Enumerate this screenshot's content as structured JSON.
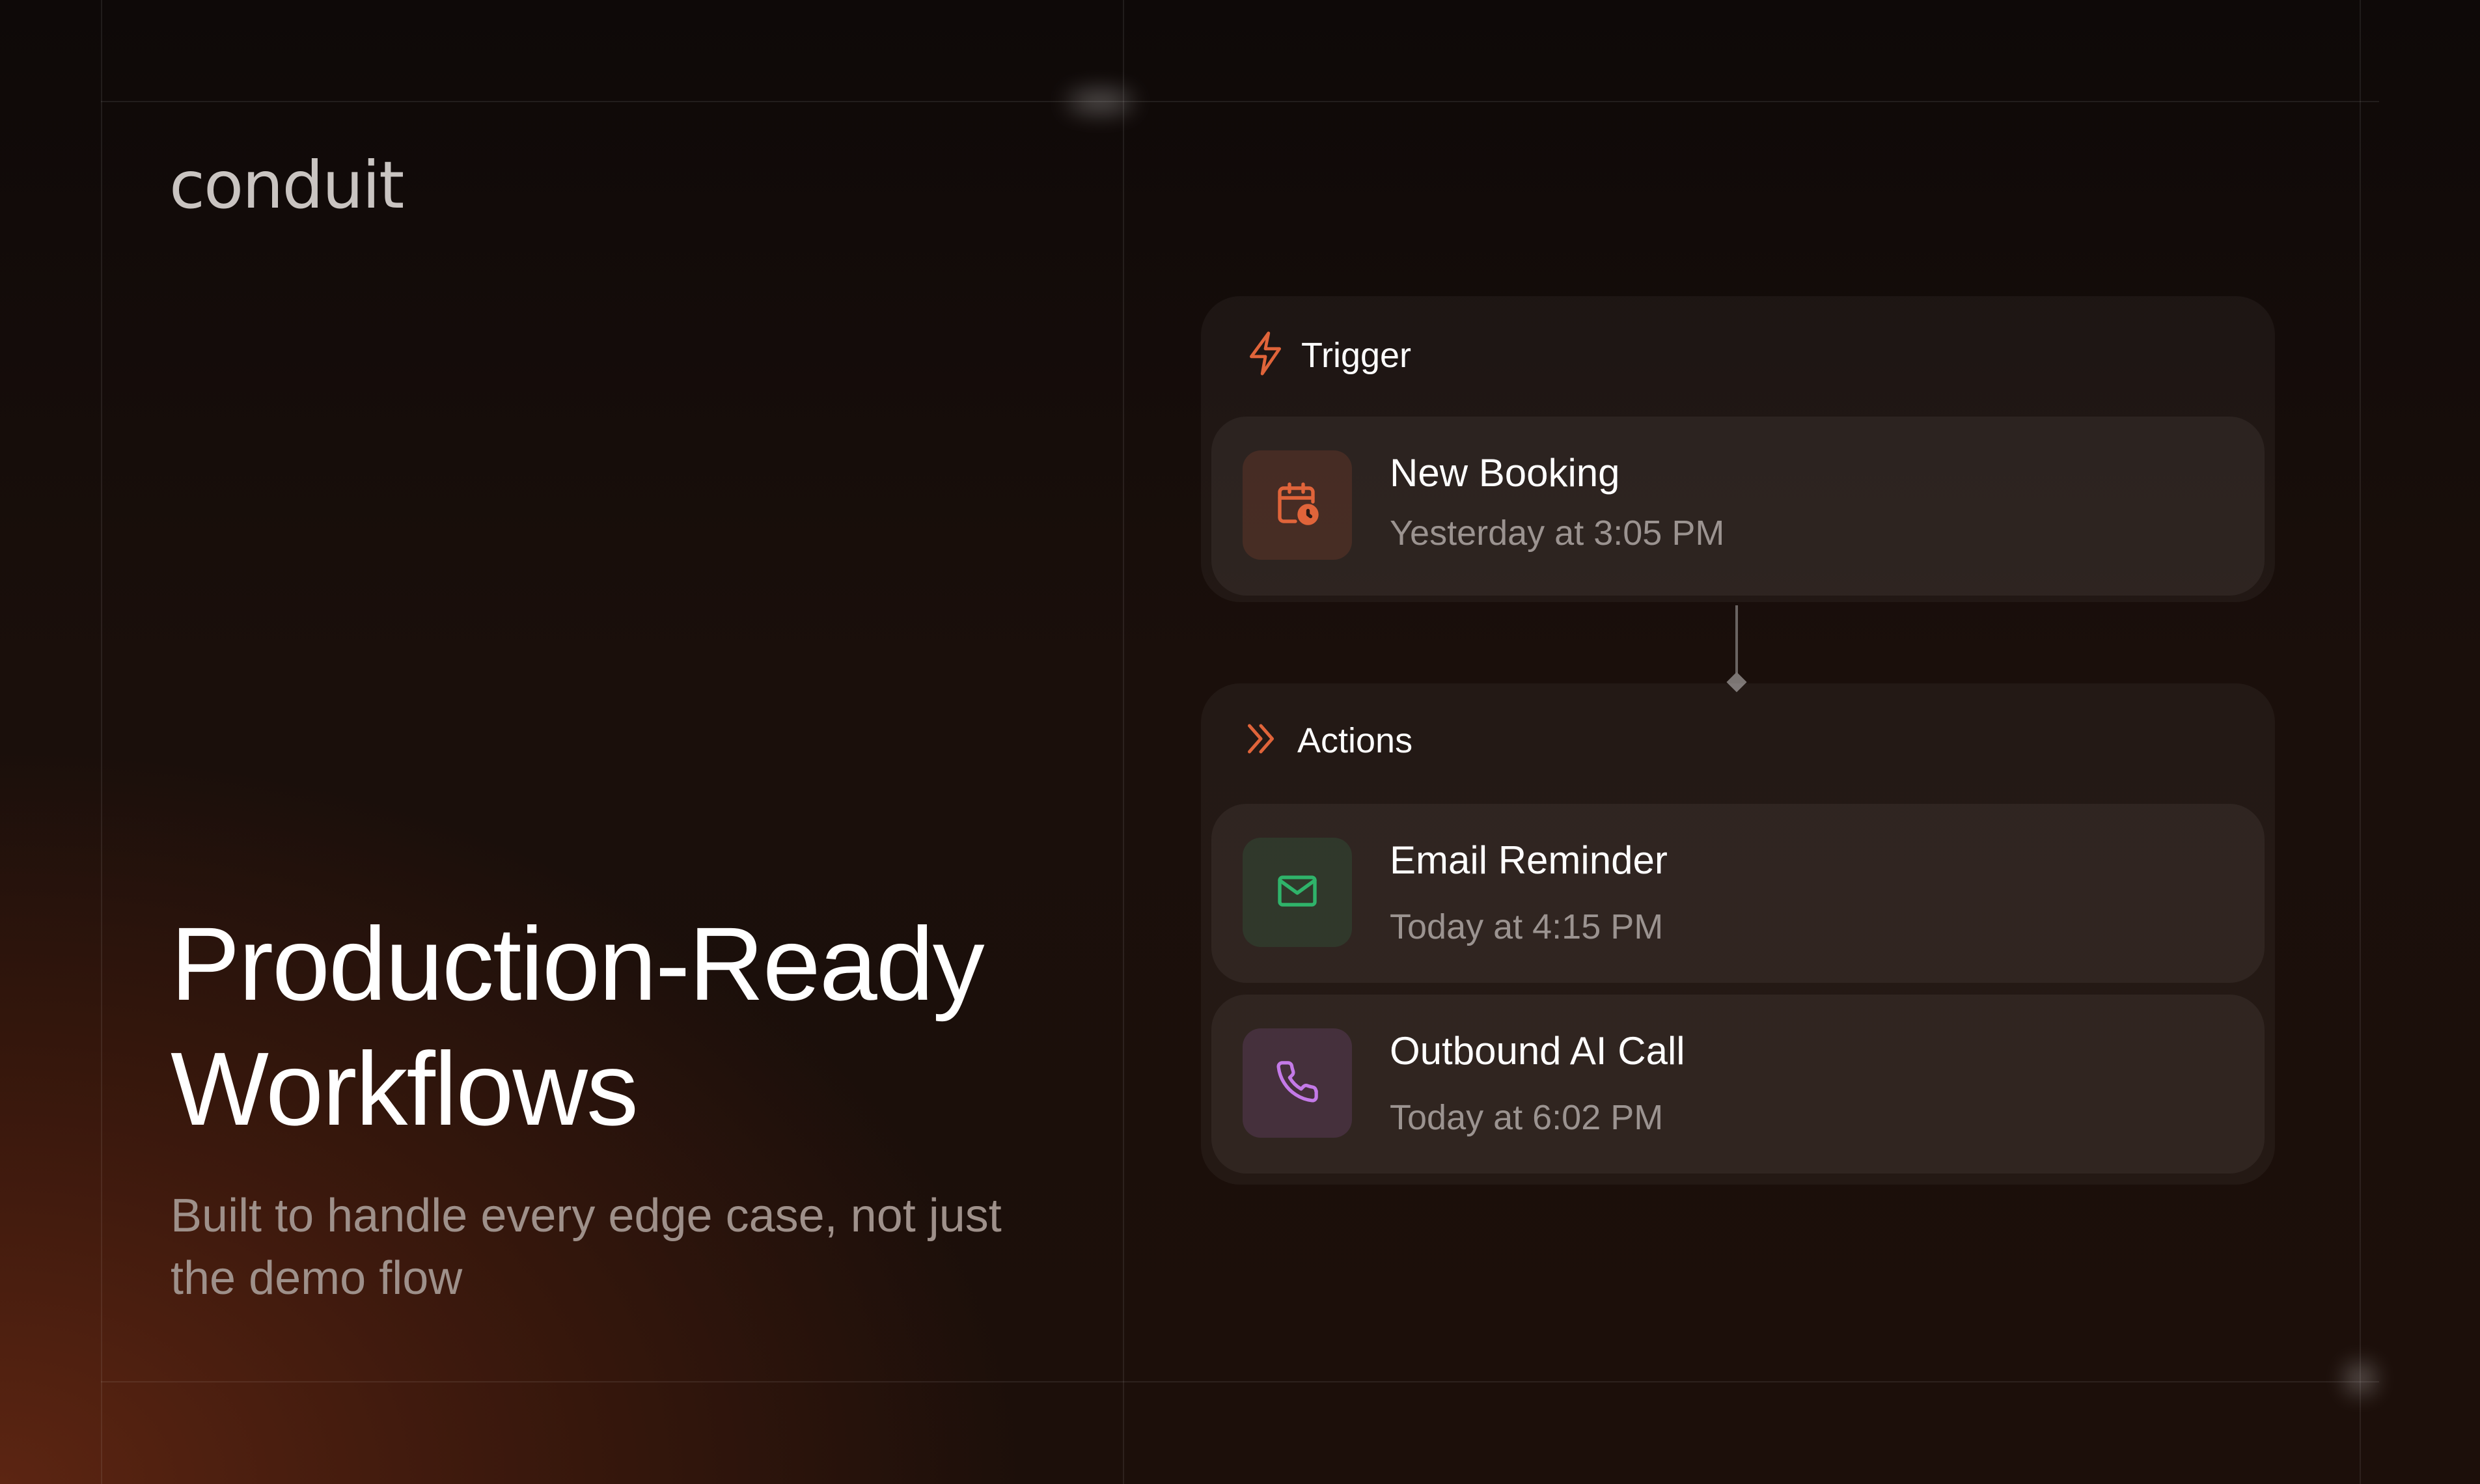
{
  "brand": {
    "logo_text": "conduit"
  },
  "hero": {
    "headline_line1": "Production-Ready",
    "headline_line2": "Workflows",
    "subhead_line1": "Built to handle every edge case, not just",
    "subhead_line2": "the demo flow"
  },
  "trigger": {
    "header_icon": "lightning-bolt-icon",
    "label": "Trigger",
    "card": {
      "icon": "calendar-clock-icon",
      "title": "New Booking",
      "time": "Yesterday at 3:05 PM"
    }
  },
  "actions": {
    "header_icon": "double-chevron-right-icon",
    "label": "Actions",
    "cards": [
      {
        "icon": "mail-icon",
        "title": "Email Reminder",
        "time": "Today at 4:15 PM"
      },
      {
        "icon": "phone-icon",
        "title": "Outbound AI Call",
        "time": "Today at 6:02 PM"
      }
    ]
  },
  "colors": {
    "accent_orange": "#e0643a",
    "email_green": "#2fb36a",
    "phone_purple": "#c47ae8",
    "text_muted": "#9b9390"
  }
}
